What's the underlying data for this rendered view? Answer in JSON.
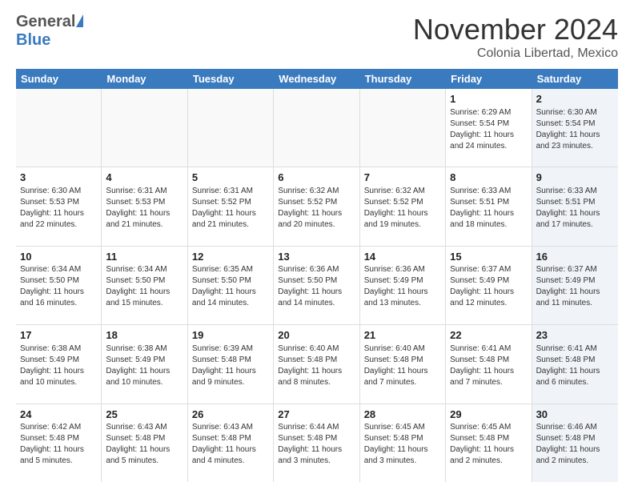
{
  "header": {
    "logo_general": "General",
    "logo_blue": "Blue",
    "month_title": "November 2024",
    "location": "Colonia Libertad, Mexico"
  },
  "calendar": {
    "days_of_week": [
      "Sunday",
      "Monday",
      "Tuesday",
      "Wednesday",
      "Thursday",
      "Friday",
      "Saturday"
    ],
    "weeks": [
      [
        {
          "day": "",
          "content": "",
          "empty": true
        },
        {
          "day": "",
          "content": "",
          "empty": true
        },
        {
          "day": "",
          "content": "",
          "empty": true
        },
        {
          "day": "",
          "content": "",
          "empty": true
        },
        {
          "day": "",
          "content": "",
          "empty": true
        },
        {
          "day": "1",
          "content": "Sunrise: 6:29 AM\nSunset: 5:54 PM\nDaylight: 11 hours\nand 24 minutes.",
          "empty": false,
          "shaded": false
        },
        {
          "day": "2",
          "content": "Sunrise: 6:30 AM\nSunset: 5:54 PM\nDaylight: 11 hours\nand 23 minutes.",
          "empty": false,
          "shaded": true
        }
      ],
      [
        {
          "day": "3",
          "content": "Sunrise: 6:30 AM\nSunset: 5:53 PM\nDaylight: 11 hours\nand 22 minutes.",
          "empty": false,
          "shaded": false
        },
        {
          "day": "4",
          "content": "Sunrise: 6:31 AM\nSunset: 5:53 PM\nDaylight: 11 hours\nand 21 minutes.",
          "empty": false,
          "shaded": false
        },
        {
          "day": "5",
          "content": "Sunrise: 6:31 AM\nSunset: 5:52 PM\nDaylight: 11 hours\nand 21 minutes.",
          "empty": false,
          "shaded": false
        },
        {
          "day": "6",
          "content": "Sunrise: 6:32 AM\nSunset: 5:52 PM\nDaylight: 11 hours\nand 20 minutes.",
          "empty": false,
          "shaded": false
        },
        {
          "day": "7",
          "content": "Sunrise: 6:32 AM\nSunset: 5:52 PM\nDaylight: 11 hours\nand 19 minutes.",
          "empty": false,
          "shaded": false
        },
        {
          "day": "8",
          "content": "Sunrise: 6:33 AM\nSunset: 5:51 PM\nDaylight: 11 hours\nand 18 minutes.",
          "empty": false,
          "shaded": false
        },
        {
          "day": "9",
          "content": "Sunrise: 6:33 AM\nSunset: 5:51 PM\nDaylight: 11 hours\nand 17 minutes.",
          "empty": false,
          "shaded": true
        }
      ],
      [
        {
          "day": "10",
          "content": "Sunrise: 6:34 AM\nSunset: 5:50 PM\nDaylight: 11 hours\nand 16 minutes.",
          "empty": false,
          "shaded": false
        },
        {
          "day": "11",
          "content": "Sunrise: 6:34 AM\nSunset: 5:50 PM\nDaylight: 11 hours\nand 15 minutes.",
          "empty": false,
          "shaded": false
        },
        {
          "day": "12",
          "content": "Sunrise: 6:35 AM\nSunset: 5:50 PM\nDaylight: 11 hours\nand 14 minutes.",
          "empty": false,
          "shaded": false
        },
        {
          "day": "13",
          "content": "Sunrise: 6:36 AM\nSunset: 5:50 PM\nDaylight: 11 hours\nand 14 minutes.",
          "empty": false,
          "shaded": false
        },
        {
          "day": "14",
          "content": "Sunrise: 6:36 AM\nSunset: 5:49 PM\nDaylight: 11 hours\nand 13 minutes.",
          "empty": false,
          "shaded": false
        },
        {
          "day": "15",
          "content": "Sunrise: 6:37 AM\nSunset: 5:49 PM\nDaylight: 11 hours\nand 12 minutes.",
          "empty": false,
          "shaded": false
        },
        {
          "day": "16",
          "content": "Sunrise: 6:37 AM\nSunset: 5:49 PM\nDaylight: 11 hours\nand 11 minutes.",
          "empty": false,
          "shaded": true
        }
      ],
      [
        {
          "day": "17",
          "content": "Sunrise: 6:38 AM\nSunset: 5:49 PM\nDaylight: 11 hours\nand 10 minutes.",
          "empty": false,
          "shaded": false
        },
        {
          "day": "18",
          "content": "Sunrise: 6:38 AM\nSunset: 5:49 PM\nDaylight: 11 hours\nand 10 minutes.",
          "empty": false,
          "shaded": false
        },
        {
          "day": "19",
          "content": "Sunrise: 6:39 AM\nSunset: 5:48 PM\nDaylight: 11 hours\nand 9 minutes.",
          "empty": false,
          "shaded": false
        },
        {
          "day": "20",
          "content": "Sunrise: 6:40 AM\nSunset: 5:48 PM\nDaylight: 11 hours\nand 8 minutes.",
          "empty": false,
          "shaded": false
        },
        {
          "day": "21",
          "content": "Sunrise: 6:40 AM\nSunset: 5:48 PM\nDaylight: 11 hours\nand 7 minutes.",
          "empty": false,
          "shaded": false
        },
        {
          "day": "22",
          "content": "Sunrise: 6:41 AM\nSunset: 5:48 PM\nDaylight: 11 hours\nand 7 minutes.",
          "empty": false,
          "shaded": false
        },
        {
          "day": "23",
          "content": "Sunrise: 6:41 AM\nSunset: 5:48 PM\nDaylight: 11 hours\nand 6 minutes.",
          "empty": false,
          "shaded": true
        }
      ],
      [
        {
          "day": "24",
          "content": "Sunrise: 6:42 AM\nSunset: 5:48 PM\nDaylight: 11 hours\nand 5 minutes.",
          "empty": false,
          "shaded": false
        },
        {
          "day": "25",
          "content": "Sunrise: 6:43 AM\nSunset: 5:48 PM\nDaylight: 11 hours\nand 5 minutes.",
          "empty": false,
          "shaded": false
        },
        {
          "day": "26",
          "content": "Sunrise: 6:43 AM\nSunset: 5:48 PM\nDaylight: 11 hours\nand 4 minutes.",
          "empty": false,
          "shaded": false
        },
        {
          "day": "27",
          "content": "Sunrise: 6:44 AM\nSunset: 5:48 PM\nDaylight: 11 hours\nand 3 minutes.",
          "empty": false,
          "shaded": false
        },
        {
          "day": "28",
          "content": "Sunrise: 6:45 AM\nSunset: 5:48 PM\nDaylight: 11 hours\nand 3 minutes.",
          "empty": false,
          "shaded": false
        },
        {
          "day": "29",
          "content": "Sunrise: 6:45 AM\nSunset: 5:48 PM\nDaylight: 11 hours\nand 2 minutes.",
          "empty": false,
          "shaded": false
        },
        {
          "day": "30",
          "content": "Sunrise: 6:46 AM\nSunset: 5:48 PM\nDaylight: 11 hours\nand 2 minutes.",
          "empty": false,
          "shaded": true
        }
      ]
    ]
  }
}
